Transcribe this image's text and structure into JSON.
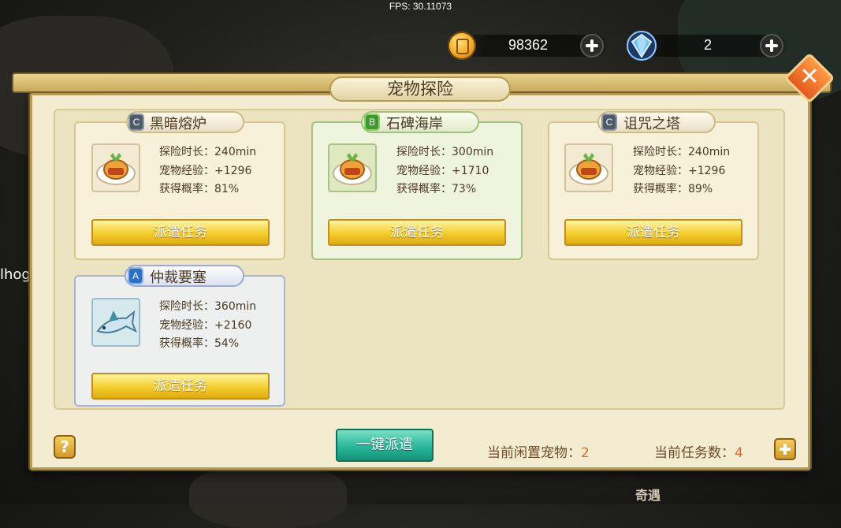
{
  "fps_label": "FPS: 30.11073",
  "currency": {
    "gold_value": "98362",
    "gem_value": "2"
  },
  "panel": {
    "title": "宠物探险"
  },
  "missions": [
    {
      "grade": "C",
      "name": "黑暗熔炉",
      "duration": "探险时长：240min",
      "exp": "宠物经验：+1296",
      "rate": "获得概率：81%",
      "button": "派遣任务"
    },
    {
      "grade": "B",
      "name": "石碑海岸",
      "duration": "探险时长：300min",
      "exp": "宠物经验：+1710",
      "rate": "获得概率：73%",
      "button": "派遣任务"
    },
    {
      "grade": "C",
      "name": "诅咒之塔",
      "duration": "探险时长：240min",
      "exp": "宠物经验：+1296",
      "rate": "获得概率：89%",
      "button": "派遣任务"
    },
    {
      "grade": "A",
      "name": "仲裁要塞",
      "duration": "探险时长：360min",
      "exp": "宠物经验：+2160",
      "rate": "获得概率：54%",
      "button": "派遣任务"
    }
  ],
  "footer": {
    "help": "?",
    "one_click": "一键派遣",
    "idle_label": "当前闲置宠物：",
    "idle_value": "2",
    "task_label": "当前任务数：",
    "task_value": "4"
  },
  "background": {
    "side_text": "lhog",
    "bottom_label": "奇遇"
  },
  "icons": {
    "gold": "coin-icon",
    "gem": "diamond-icon",
    "close": "close-icon",
    "food": "food-plate-icon",
    "fish": "fish-icon"
  },
  "colors": {
    "gold_button": "#f3cd2c",
    "teal_button": "#28b799",
    "close_orange": "#e45a1d",
    "count_orange": "#e5692a"
  }
}
